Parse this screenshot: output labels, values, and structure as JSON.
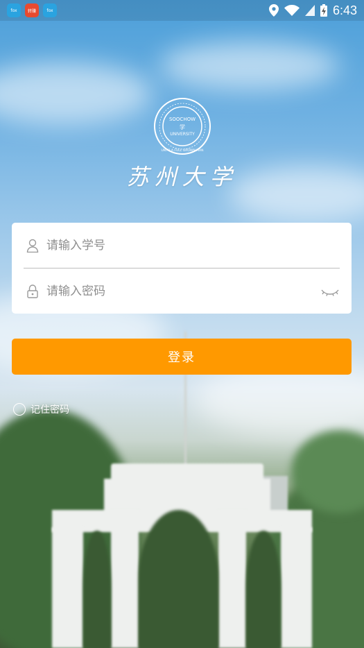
{
  "status_bar": {
    "apps": [
      {
        "icon": "app-notification-icon",
        "label": "fox"
      },
      {
        "icon": "app-notification-icon",
        "label": "转赚"
      },
      {
        "icon": "app-notification-icon",
        "label": "fox"
      }
    ],
    "time": "6:43"
  },
  "logo": {
    "university_name": "苏州大学",
    "seal_text_top": "SOOCHOW",
    "seal_text_mid": "UNIVERSITY",
    "seal_text_ring": "UNTO A FULL GROWN MAN"
  },
  "login_form": {
    "username_placeholder": "请输入学号",
    "password_placeholder": "请输入密码",
    "submit_label": "登录",
    "remember_label": "记住密码",
    "remember_checked": false
  },
  "colors": {
    "primary_button": "#ff9900",
    "card": "#ffffff",
    "placeholder": "#8e8e8e"
  }
}
